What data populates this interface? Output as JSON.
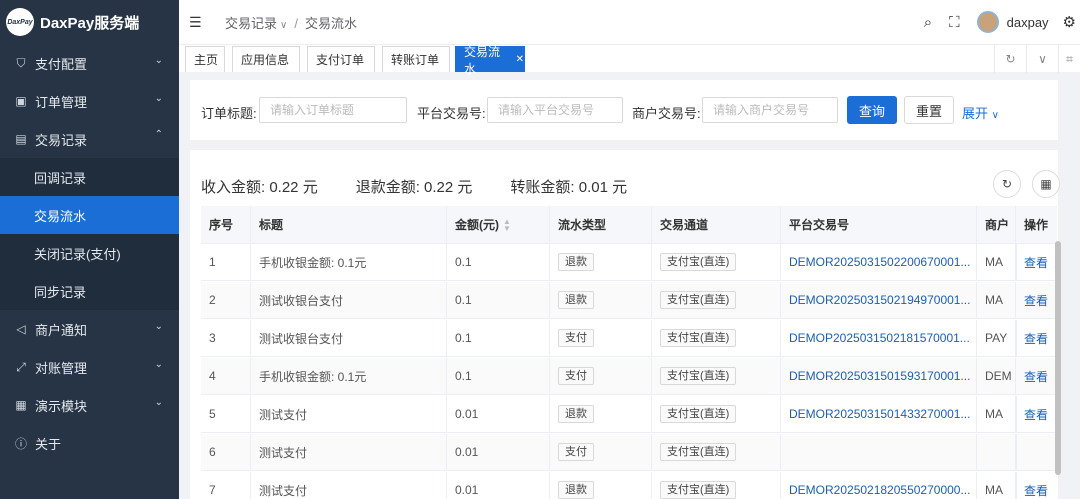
{
  "app": {
    "logo_text": "DaxPay",
    "title": "DaxPay服务端"
  },
  "sidebar": {
    "items": [
      {
        "label": "支付配置",
        "icon": "shield-icon",
        "has_children": true,
        "expanded": false
      },
      {
        "label": "订单管理",
        "icon": "order-icon",
        "has_children": true,
        "expanded": false
      },
      {
        "label": "交易记录",
        "icon": "document-icon",
        "has_children": true,
        "expanded": true
      },
      {
        "label": "商户通知",
        "icon": "megaphone-icon",
        "has_children": true,
        "expanded": false
      },
      {
        "label": "对账管理",
        "icon": "reconcile-icon",
        "has_children": true,
        "expanded": false
      },
      {
        "label": "演示模块",
        "icon": "grid-icon",
        "has_children": true,
        "expanded": false
      },
      {
        "label": "关于",
        "icon": "info-icon",
        "has_children": false,
        "expanded": false
      }
    ],
    "submenu": [
      {
        "label": "回调记录",
        "active": false
      },
      {
        "label": "交易流水",
        "active": true
      },
      {
        "label": "关闭记录(支付)",
        "active": false
      },
      {
        "label": "同步记录",
        "active": false
      }
    ]
  },
  "header": {
    "breadcrumb": [
      "交易记录",
      "交易流水"
    ],
    "username": "daxpay"
  },
  "tabs": [
    {
      "label": "主页"
    },
    {
      "label": "应用信息"
    },
    {
      "label": "支付订单"
    },
    {
      "label": "转账订单"
    },
    {
      "label": "交易流水",
      "active": true,
      "closable": true
    }
  ],
  "search": {
    "fields": [
      {
        "label": "订单标题:",
        "placeholder": "请输入订单标题"
      },
      {
        "label": "平台交易号:",
        "placeholder": "请输入平台交易号"
      },
      {
        "label": "商户交易号:",
        "placeholder": "请输入商户交易号"
      }
    ],
    "query_label": "查询",
    "reset_label": "重置",
    "expand_label": "展开"
  },
  "summary": {
    "income": "收入金额: 0.22 元",
    "refund": "退款金额: 0.22 元",
    "transfer": "转账金额: 0.01 元"
  },
  "table": {
    "columns": [
      "序号",
      "标题",
      "金额(元)",
      "流水类型",
      "交易通道",
      "平台交易号",
      "商户",
      "操作"
    ],
    "rows": [
      {
        "no": "1",
        "title": "手机收银金额: 0.1元",
        "amount": "0.1",
        "type": "退款",
        "channel": "支付宝(直连)",
        "trade_no": "DEMOR2025031502200670001...",
        "merchant": "MA",
        "action": "查看"
      },
      {
        "no": "2",
        "title": "测试收银台支付",
        "amount": "0.1",
        "type": "退款",
        "channel": "支付宝(直连)",
        "trade_no": "DEMOR2025031502194970001...",
        "merchant": "MA",
        "action": "查看"
      },
      {
        "no": "3",
        "title": "测试收银台支付",
        "amount": "0.1",
        "type": "支付",
        "channel": "支付宝(直连)",
        "trade_no": "DEMOP2025031502181570001...",
        "merchant": "PAY",
        "action": "查看"
      },
      {
        "no": "4",
        "title": "手机收银金额: 0.1元",
        "amount": "0.1",
        "type": "支付",
        "channel": "支付宝(直连)",
        "trade_no": "DEMOR2025031501593170001...",
        "merchant": "DEM",
        "action": "查看"
      },
      {
        "no": "5",
        "title": "测试支付",
        "amount": "0.01",
        "type": "退款",
        "channel": "支付宝(直连)",
        "trade_no": "DEMOR2025031501433270001...",
        "merchant": "MA",
        "action": "查看"
      },
      {
        "no": "6",
        "title": "测试支付",
        "amount": "0.01",
        "type": "支付",
        "channel": "支付宝(直连)",
        "trade_no": "",
        "merchant": "",
        "action": ""
      },
      {
        "no": "7",
        "title": "测试支付",
        "amount": "0.01",
        "type": "退款",
        "channel": "支付宝(直连)",
        "trade_no": "DEMOR2025021820550270000...",
        "merchant": "MA",
        "action": "查看"
      }
    ]
  },
  "colors": {
    "sidebar_bg": "#263445",
    "accent": "#1a6ed6",
    "link": "#1a5fb4"
  }
}
